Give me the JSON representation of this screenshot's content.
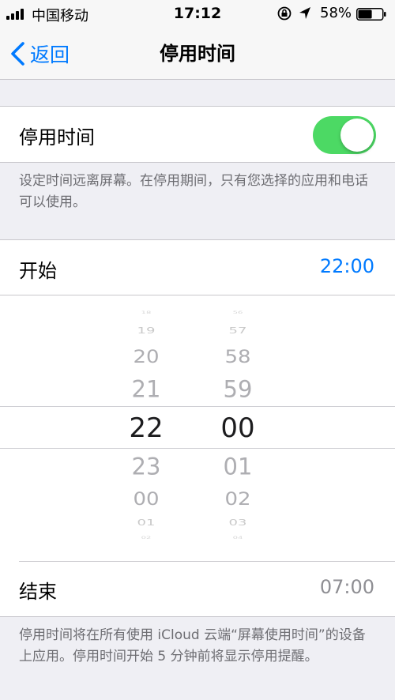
{
  "status_bar": {
    "carrier": "中国移动",
    "time": "17:12",
    "battery_percent": "58%",
    "battery_level": 0.58,
    "icons": [
      "signal-icon",
      "orientation-lock-icon",
      "location-icon",
      "battery-icon"
    ]
  },
  "nav": {
    "back_label": "返回",
    "title": "停用时间"
  },
  "downtime": {
    "toggle_label": "停用时间",
    "enabled": true,
    "toggle_color": "#4cd964",
    "description": "设定时间远离屏幕。在停用期间，只有您选择的应用和电话可以使用。"
  },
  "start": {
    "label": "开始",
    "value": "22:00",
    "value_color": "#007aff"
  },
  "picker": {
    "hours": [
      "18",
      "19",
      "20",
      "21",
      "22",
      "23",
      "00",
      "01",
      "02"
    ],
    "minutes": [
      "56",
      "57",
      "58",
      "59",
      "00",
      "01",
      "02",
      "03",
      "04"
    ],
    "selected_hour": "22",
    "selected_minute": "00"
  },
  "end": {
    "label": "结束",
    "value": "07:00"
  },
  "footer_note": "停用时间将在所有使用 iCloud 云端“屏幕使用时间”的设备上应用。停用时间开始 5 分钟前将显示停用提醒。"
}
